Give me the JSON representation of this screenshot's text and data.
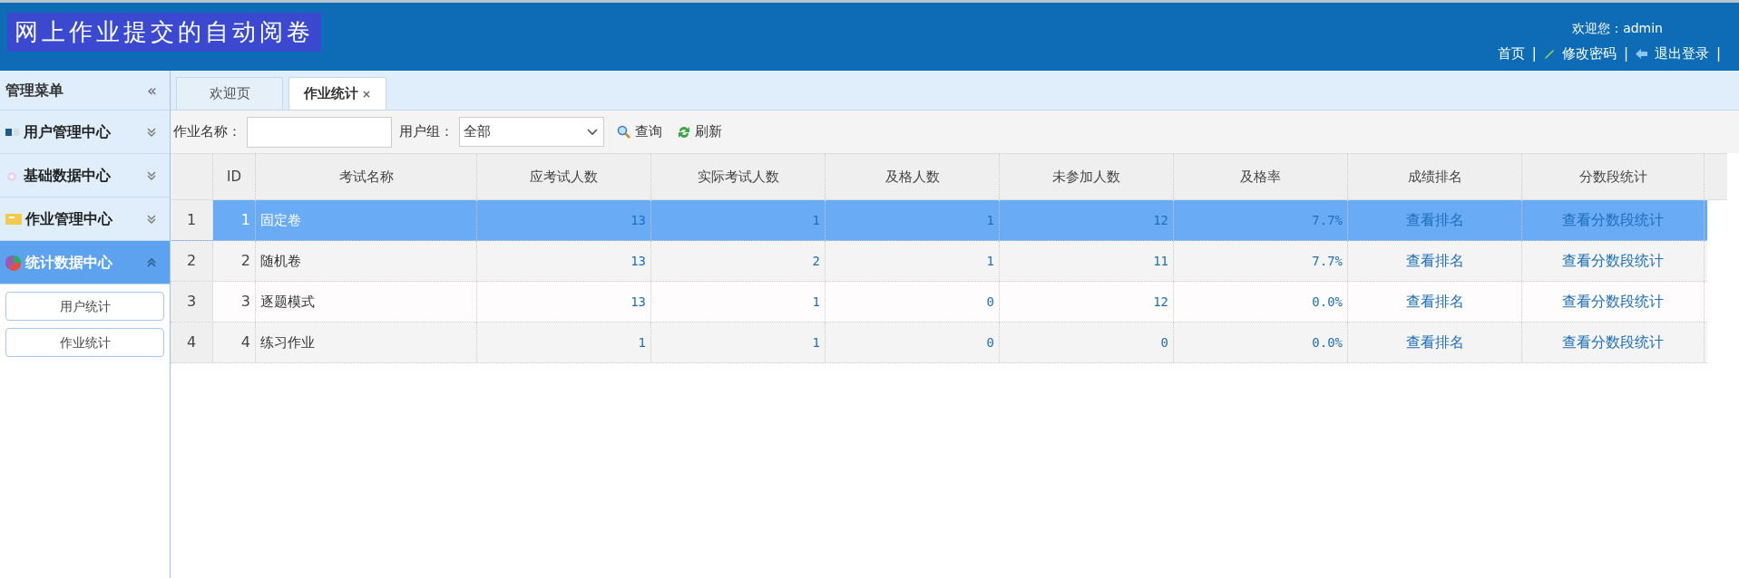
{
  "header": {
    "title": "网上作业提交的自动阅卷",
    "welcome": "欢迎您：admin",
    "link_separator": "|",
    "links": [
      {
        "label": "首页"
      },
      {
        "label": "修改密码"
      },
      {
        "label": "退出登录"
      }
    ]
  },
  "sidebar": {
    "title": "管理菜单",
    "collapse": "«",
    "items": [
      {
        "label": "用户管理中心",
        "expanded": false,
        "selected": false
      },
      {
        "label": "基础数据中心",
        "expanded": false,
        "selected": false
      },
      {
        "label": "作业管理中心",
        "expanded": false,
        "selected": false
      },
      {
        "label": "统计数据中心",
        "expanded": true,
        "selected": true,
        "children": [
          {
            "label": "用户统计"
          },
          {
            "label": "作业统计"
          }
        ]
      }
    ]
  },
  "tabs": [
    {
      "label": "欢迎页",
      "selected": false
    },
    {
      "label": "作业统计",
      "selected": true,
      "close": "×"
    }
  ],
  "toolbar": {
    "name_label": "作业名称：",
    "group_label": "用户组：",
    "group_value": "全部",
    "search_button": "查询",
    "refresh_button": "刷新"
  },
  "table": {
    "columns": [
      "ID",
      "考试名称",
      "应考试人数",
      "实际考试人数",
      "及格人数",
      "未参加人数",
      "及格率",
      "成绩排名",
      "分数段统计"
    ],
    "rows": [
      {
        "index": "1",
        "selected": true,
        "cells": [
          "1",
          "固定卷",
          "13",
          "1",
          "1",
          "12",
          "7.7%",
          "查看排名",
          "查看分数段统计"
        ]
      },
      {
        "index": "2",
        "selected": false,
        "cells": [
          "2",
          "随机卷",
          "13",
          "2",
          "1",
          "11",
          "7.7%",
          "查看排名",
          "查看分数段统计"
        ]
      },
      {
        "index": "3",
        "selected": false,
        "cells": [
          "3",
          "逐题模式",
          "13",
          "1",
          "0",
          "12",
          "0.0%",
          "查看排名",
          "查看分数段统计"
        ]
      },
      {
        "index": "4",
        "selected": false,
        "cells": [
          "4",
          "练习作业",
          "1",
          "1",
          "0",
          "0",
          "0.0%",
          "查看排名",
          "查看分数段统计"
        ]
      }
    ]
  }
}
